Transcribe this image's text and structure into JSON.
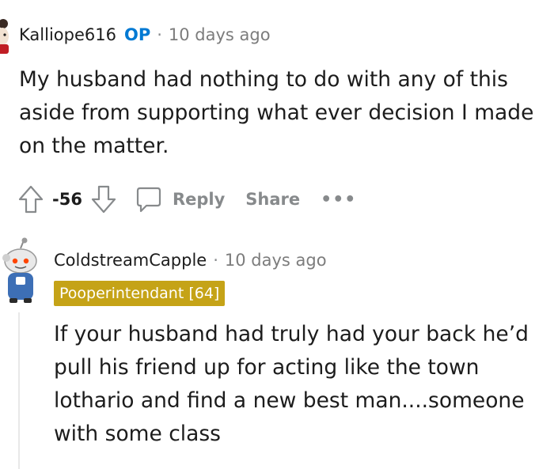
{
  "comment1": {
    "username": "Kalliope616",
    "op_badge": "OP",
    "separator": "·",
    "timestamp": "10 days ago",
    "body": "My husband had nothing to do with any of this aside from supporting what ever decision I made on the matter."
  },
  "actions": {
    "upvote_icon": "upvote-arrow-icon",
    "score": "-56",
    "downvote_icon": "downvote-arrow-icon",
    "reply_icon": "speech-bubble-icon",
    "reply_label": "Reply",
    "share_label": "Share",
    "more_label": "•••"
  },
  "comment2": {
    "username": "ColdstreamCapple",
    "separator": "·",
    "timestamp": "10 days ago",
    "flair": "Pooperintendant [64]",
    "body": "If your husband had truly had your back he’d pull his friend up for acting like the town lothario and find a new best man....someone with some class"
  },
  "colors": {
    "op_blue": "#0079d3",
    "flair_gold": "#c5a317",
    "meta_gray": "#878a8c",
    "text": "#1c1c1c"
  }
}
